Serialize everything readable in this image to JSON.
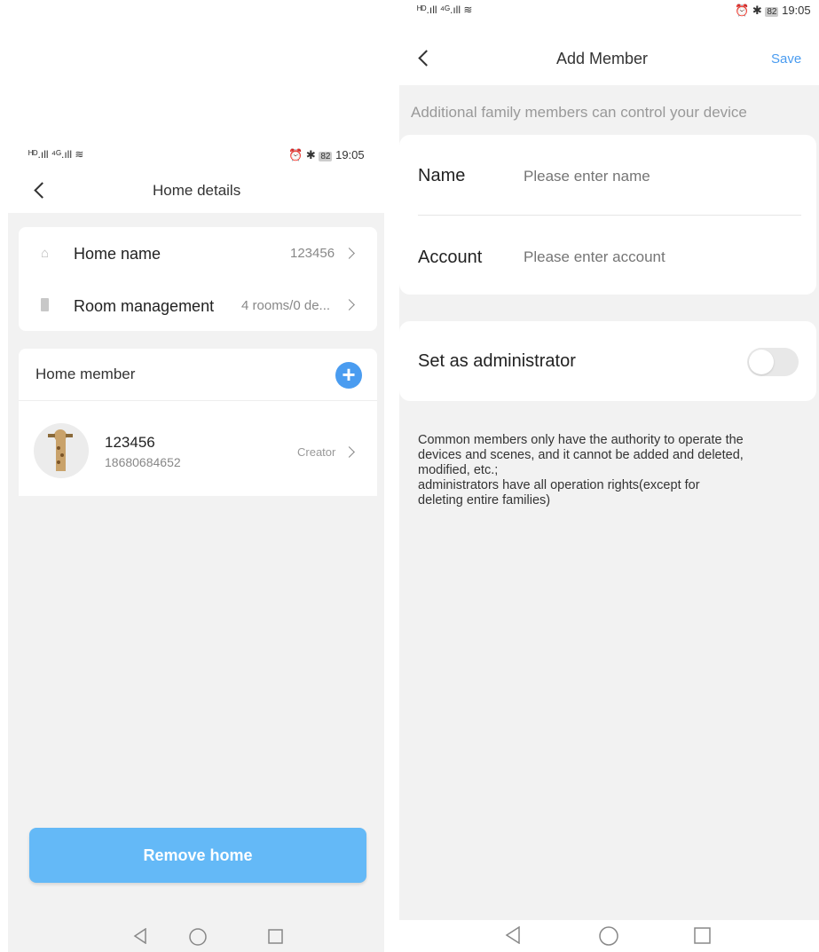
{
  "left": {
    "status": {
      "left_icons": "ᴴᴰ.ıll ⁴ᴳ.ıll ≋",
      "right_time": "19:05",
      "battery": "82"
    },
    "header": {
      "title": "Home details"
    },
    "home_name": {
      "label": "Home name",
      "value": "123456"
    },
    "room_management": {
      "label": "Room management",
      "value": "4 rooms/0 de..."
    },
    "members_section": {
      "title": "Home member"
    },
    "member": {
      "name": "123456",
      "phone": "18680684652",
      "role": "Creator"
    },
    "remove_button": "Remove home"
  },
  "right": {
    "status": {
      "left_icons": "ᴴᴰ.ıll ⁴ᴳ.ıll ≋",
      "right_time": "19:05",
      "battery": "82"
    },
    "header": {
      "title": "Add Member",
      "save": "Save"
    },
    "subtitle": "Additional family members can control your device",
    "name_field": {
      "label": "Name",
      "placeholder": "Please enter name"
    },
    "account_field": {
      "label": "Account",
      "placeholder": "Please enter account"
    },
    "admin_toggle": {
      "label": "Set as administrator",
      "on": false
    },
    "note": [
      "Common members only have the authority to operate the",
      "devices and scenes, and it cannot be added and deleted,",
      "modified, etc.;",
      "administrators have all operation rights(except for",
      "deleting entire families)"
    ]
  },
  "colors": {
    "accent": "#4a9cf0",
    "button": "#64b9f7",
    "bg": "#f2f2f2"
  }
}
